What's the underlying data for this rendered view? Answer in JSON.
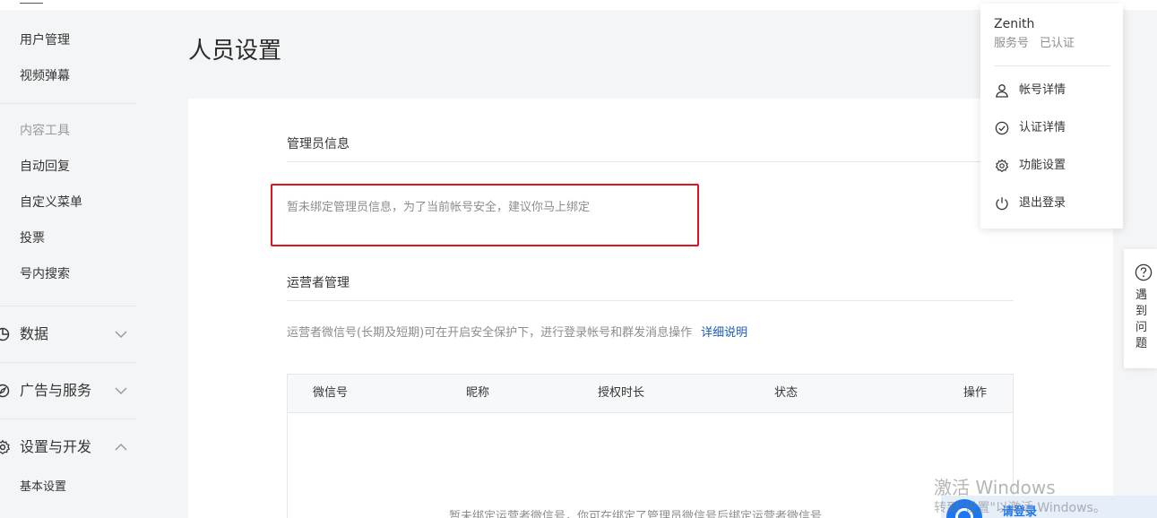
{
  "sidebar": {
    "items_top": [
      {
        "label": "用户管理"
      },
      {
        "label": "视频弹幕"
      }
    ],
    "content_tools": {
      "group_label": "内容工具",
      "items": [
        {
          "label": "自动回复"
        },
        {
          "label": "自定义菜单"
        },
        {
          "label": "投票"
        },
        {
          "label": "号内搜索"
        }
      ]
    },
    "sections": [
      {
        "label": "数据",
        "icon": "chart-icon",
        "state": "collapsed"
      },
      {
        "label": "广告与服务",
        "icon": "compass-icon",
        "state": "collapsed"
      },
      {
        "label": "设置与开发",
        "icon": "gear-icon",
        "state": "expanded"
      }
    ],
    "settings_items": [
      {
        "label": "基本设置"
      }
    ]
  },
  "page": {
    "title": "人员设置"
  },
  "admin_section": {
    "title": "管理员信息",
    "notice": "暂未绑定管理员信息，为了当前帐号安全，建议你马上绑定"
  },
  "operator_section": {
    "title": "运营者管理",
    "description": "运营者微信号(长期及短期)可在开启安全保护下，进行登录帐号和群发消息操作",
    "link": "详细说明",
    "table": {
      "columns": [
        "微信号",
        "昵称",
        "授权时长",
        "状态",
        "操作"
      ],
      "empty_text": "暂未绑定运营者微信号，你可在绑定了管理员微信号后绑定运营者微信号"
    }
  },
  "account_menu": {
    "name": "Zenith",
    "type": "服务号",
    "verified": "已认证",
    "items": [
      {
        "label": "帐号详情",
        "icon": "user-icon"
      },
      {
        "label": "认证详情",
        "icon": "check-circle-icon"
      },
      {
        "label": "功能设置",
        "icon": "gear-icon"
      },
      {
        "label": "退出登录",
        "icon": "power-icon"
      }
    ]
  },
  "help": {
    "label": "遇到问题"
  },
  "watermark": {
    "line1": "激活 Windows",
    "line2": "转到\"设置\"以激活 Windows。"
  },
  "login_widget": {
    "label": "请登录"
  },
  "colors": {
    "accent_link": "#1c5bb4",
    "highlight_border": "#e0141e",
    "page_bg": "#f4f5f6"
  }
}
